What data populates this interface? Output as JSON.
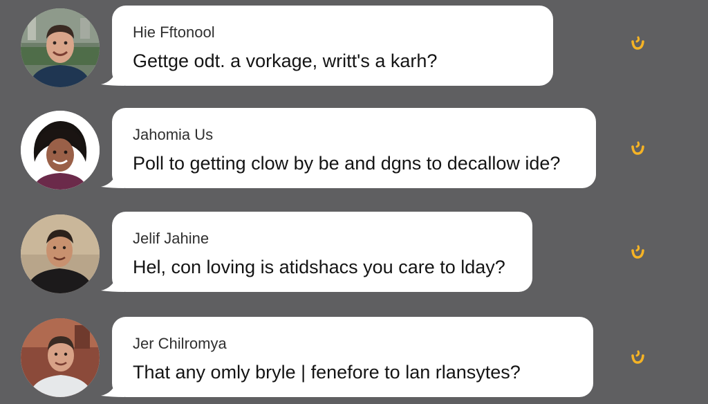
{
  "messages": [
    {
      "sender": "Hie Fftonool",
      "text": "Gettge odt. a vorkage, writt's a karh?",
      "accent": "#f5b325",
      "icon": "smiley-reaction-icon"
    },
    {
      "sender": "Jahomia Us",
      "text": "Poll to getting clow by be and dgns to decallow ide?",
      "accent": "#f5b325",
      "icon": "smiley-reaction-icon"
    },
    {
      "sender": "Jelif Jahine",
      "text": "Hel, con loving is atidshacs you care to lday?",
      "accent": "#f5b325",
      "icon": "smiley-reaction-icon"
    },
    {
      "sender": "Jer Chilromya",
      "text": "That any omly bryle | fenefore to lan rlansytes?",
      "accent": "#f5b325",
      "icon": "smiley-reaction-icon"
    }
  ],
  "colors": {
    "background": "#5f5f61",
    "bubble": "#ffffff",
    "reaction": "#f5b325"
  }
}
